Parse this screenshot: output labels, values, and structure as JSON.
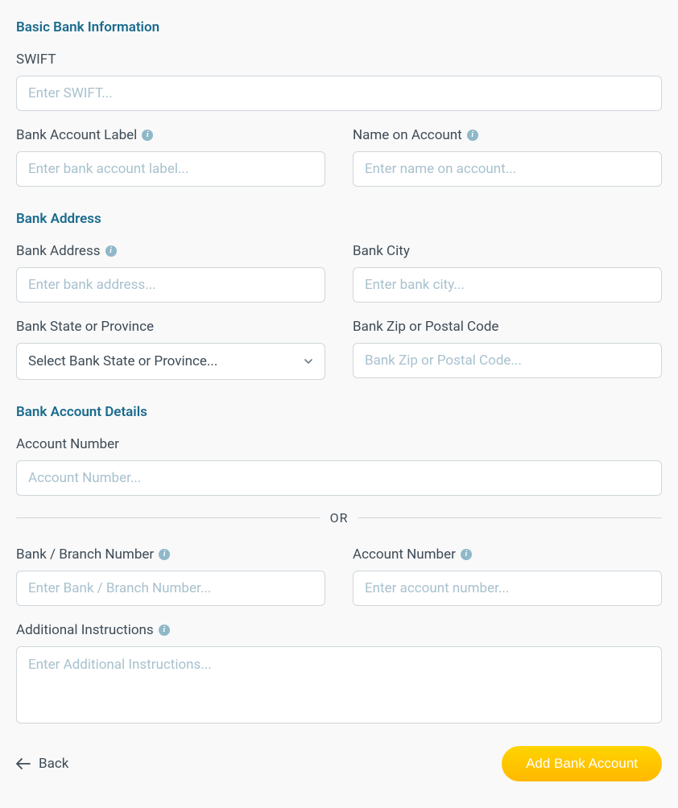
{
  "sections": {
    "basic": {
      "heading": "Basic Bank Information",
      "swift": {
        "label": "SWIFT",
        "placeholder": "Enter SWIFT..."
      },
      "account_label": {
        "label": "Bank Account Label",
        "placeholder": "Enter bank account label..."
      },
      "name_on_account": {
        "label": "Name on Account",
        "placeholder": "Enter name on account..."
      }
    },
    "address": {
      "heading": "Bank Address",
      "bank_address": {
        "label": "Bank Address",
        "placeholder": "Enter bank address..."
      },
      "bank_city": {
        "label": "Bank City",
        "placeholder": "Enter bank city..."
      },
      "bank_state": {
        "label": "Bank State or Province",
        "placeholder_option": "Select Bank State or Province..."
      },
      "bank_zip": {
        "label": "Bank Zip or Postal Code",
        "placeholder": "Bank Zip or Postal Code..."
      }
    },
    "details": {
      "heading": "Bank Account Details",
      "account_number_full": {
        "label": "Account Number",
        "placeholder": "Account Number..."
      },
      "or_text": "OR",
      "branch_number": {
        "label": "Bank / Branch Number",
        "placeholder": "Enter Bank / Branch Number..."
      },
      "account_number2": {
        "label": "Account Number",
        "placeholder": "Enter account number..."
      },
      "additional": {
        "label": "Additional Instructions",
        "placeholder": "Enter Additional Instructions..."
      }
    }
  },
  "footer": {
    "back": "Back",
    "submit": "Add Bank Account"
  }
}
